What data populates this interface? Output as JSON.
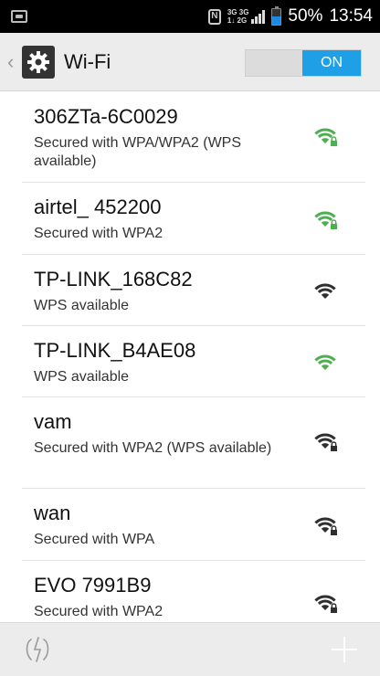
{
  "status_bar": {
    "net_top": "3G 3G",
    "net_bottom": "1↓ 2G",
    "battery_percent": "50%",
    "battery_level": 0.5,
    "time": "13:54",
    "nfc_label": "N"
  },
  "action_bar": {
    "back_glyph": "‹",
    "title": "Wi-Fi",
    "toggle_label": "ON"
  },
  "networks": [
    {
      "ssid": "306ZTa-6C0029",
      "security": "Secured with WPA/WPA2 (WPS available)",
      "signal_bars": 3,
      "locked": true,
      "color": "#4caf50"
    },
    {
      "ssid": "airtel_ 452200",
      "security": "Secured with WPA2",
      "signal_bars": 3,
      "locked": true,
      "color": "#4caf50"
    },
    {
      "ssid": "TP-LINK_168C82",
      "security": "WPS available",
      "signal_bars": 3,
      "locked": false,
      "color": "#2f2f2f"
    },
    {
      "ssid": "TP-LINK_B4AE08",
      "security": "WPS available",
      "signal_bars": 3,
      "locked": false,
      "color": "#4caf50"
    },
    {
      "ssid": "vam",
      "security": "Secured with WPA2 (WPS available)",
      "signal_bars": 3,
      "locked": true,
      "color": "#2f2f2f"
    },
    {
      "ssid": "wan",
      "security": "Secured with WPA",
      "signal_bars": 3,
      "locked": true,
      "color": "#2f2f2f"
    },
    {
      "ssid": "EVO 7991B9",
      "security": "Secured with WPA2",
      "signal_bars": 3,
      "locked": true,
      "color": "#2f2f2f"
    }
  ],
  "icons": {
    "settings": "gear-icon",
    "wps": "wps-icon",
    "add": "plus-icon"
  },
  "colors": {
    "accent": "#1e9fe6",
    "signal_green": "#4caf50",
    "signal_dark": "#2f2f2f"
  }
}
